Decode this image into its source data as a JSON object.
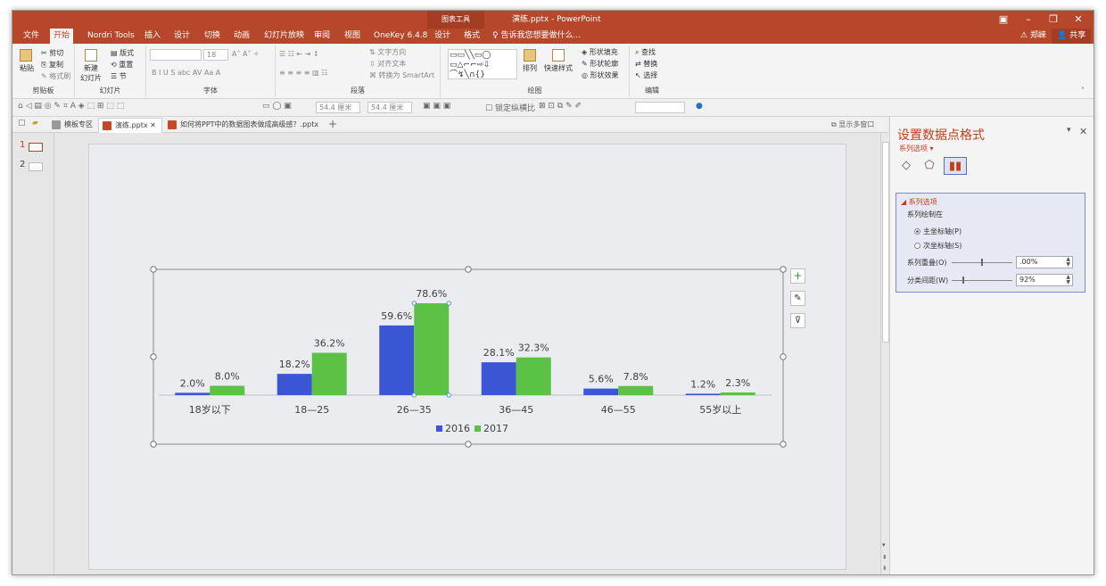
{
  "window": {
    "context_label": "图表工具",
    "title": "演练.pptx - PowerPoint"
  },
  "menu": {
    "tabs": [
      "文件",
      "开始",
      "Nordri Tools",
      "插入",
      "设计",
      "切换",
      "动画",
      "幻灯片放映",
      "审阅",
      "视图",
      "OneKey 6.4.8",
      "设计",
      "格式"
    ],
    "active_index": 1,
    "tell_me": "告诉我您想要做什么...",
    "user": "郑崃",
    "share": "共享"
  },
  "ribbon": {
    "clipboard": {
      "paste": "粘贴",
      "cut": "剪切",
      "copy": "复制",
      "painter": "格式刷",
      "label": "剪贴板"
    },
    "slides": {
      "new_slide": "新建",
      "new_slide2": "幻灯片",
      "layout": "版式",
      "reset": "重置",
      "section": "节",
      "label": "幻灯片"
    },
    "font": {
      "size": "18",
      "label": "字体"
    },
    "paragraph": {
      "text_dir": "文字方向",
      "align_text": "对齐文本",
      "smartart": "转换为 SmartArt",
      "label": "段落"
    },
    "drawing": {
      "arrange": "排列",
      "quick_styles": "快速样式",
      "fill": "形状填充",
      "outline": "形状轮廓",
      "effect": "形状效果",
      "label": "绘图"
    },
    "editing": {
      "find": "查找",
      "replace": "替换",
      "select": "选择",
      "label": "编辑"
    }
  },
  "qat": {
    "w1": "54.4 厘米",
    "w2": "54.4 厘米",
    "lock": "锁定纵横比"
  },
  "doc_tabs": [
    {
      "label": "模板专区",
      "active": false
    },
    {
      "label": "演练.pptx",
      "active": true
    },
    {
      "label": "如何将PPT中的数据图表做成高级感？.pptx",
      "active": false
    }
  ],
  "multi_window": "显示多窗口",
  "slides": [
    {
      "num": "1"
    },
    {
      "num": "2"
    }
  ],
  "panel": {
    "title": "设置数据点格式",
    "subtitle": "系列选项",
    "section": "系列选项",
    "plot_on": "系列绘制在",
    "primary": "主坐标轴(P)",
    "secondary": "次坐标轴(S)",
    "overlap_label": "系列重叠(O)",
    "overlap_value": ".00%",
    "gap_label": "分类间距(W)",
    "gap_value": "92%"
  },
  "chart_data": {
    "type": "bar",
    "categories": [
      "18岁以下",
      "18—25",
      "26—35",
      "36—45",
      "46—55",
      "55岁以上"
    ],
    "series": [
      {
        "name": "2016",
        "values": [
          2.0,
          18.2,
          59.6,
          28.1,
          5.6,
          1.2
        ],
        "labels": [
          "2.0%",
          "18.2%",
          "59.6%",
          "28.1%",
          "5.6%",
          "1.2%"
        ],
        "color": "#3a56d4"
      },
      {
        "name": "2017",
        "values": [
          8.0,
          36.2,
          78.6,
          32.3,
          7.8,
          2.3
        ],
        "labels": [
          "8.0%",
          "36.2%",
          "78.6%",
          "32.3%",
          "7.8%",
          "2.3%"
        ],
        "color": "#5cc245"
      }
    ],
    "ylim": [
      0,
      80
    ],
    "legend": "bottom",
    "grid": false,
    "selected_point": {
      "series": 1,
      "index": 2
    }
  }
}
